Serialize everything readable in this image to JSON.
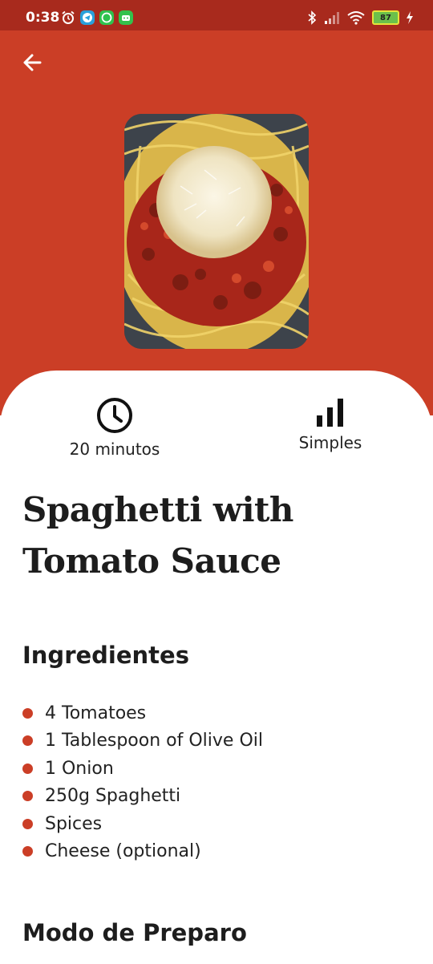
{
  "status_bar": {
    "time": "0:38",
    "battery": "87"
  },
  "header": {
    "back_icon": "arrow-left-icon",
    "background_color": "#cb3e26"
  },
  "recipe": {
    "photo_icon": "spaghetti-photo",
    "time_icon": "clock-icon",
    "time_label": "20 minutos",
    "difficulty_icon": "bar-chart-icon",
    "difficulty_label": "Simples",
    "title": "Spaghetti with Tomato Sauce",
    "ingredients_heading": "Ingredientes",
    "ingredients": [
      "4 Tomatoes",
      "1 Tablespoon of Olive Oil",
      "1 Onion",
      "250g Spaghetti",
      "Spices",
      "Cheese (optional)"
    ],
    "preparation_heading": "Modo de Preparo"
  },
  "colors": {
    "accent": "#cb3e26",
    "status_bar": "#a82a1d",
    "text": "#1d1d1d"
  }
}
